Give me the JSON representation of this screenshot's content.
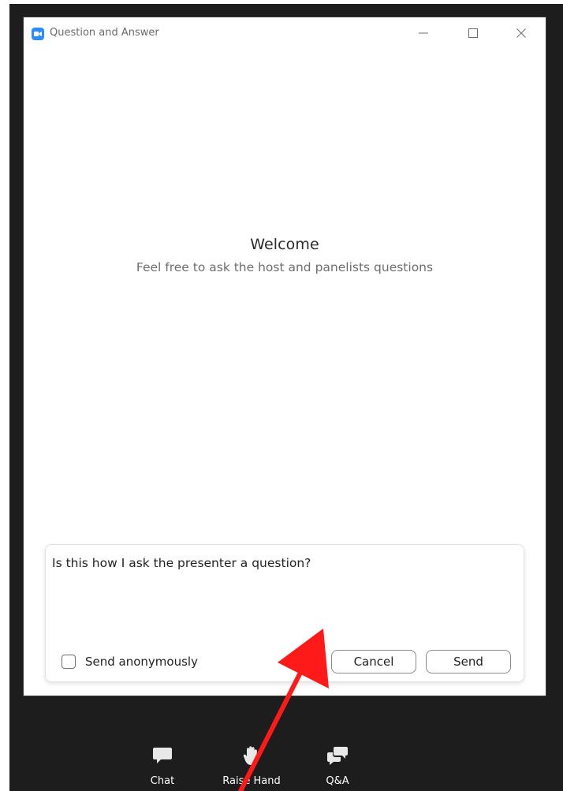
{
  "window": {
    "title": "Question and Answer",
    "controls": {
      "minimize_icon": "minimize-icon",
      "maximize_icon": "maximize-icon",
      "close_icon": "close-icon"
    }
  },
  "welcome": {
    "title": "Welcome",
    "subtitle": "Feel free to ask the host and panelists questions"
  },
  "compose": {
    "question_value": "Is this how I ask the presenter a question?",
    "anonymous_label": "Send anonymously",
    "anonymous_checked": false,
    "cancel_label": "Cancel",
    "send_label": "Send"
  },
  "toolbar": {
    "items": [
      {
        "label": "Chat",
        "icon": "chat-icon"
      },
      {
        "label": "Raise Hand",
        "icon": "raise-hand-icon"
      },
      {
        "label": "Q&A",
        "icon": "qa-icon"
      }
    ]
  },
  "colors": {
    "accent": "#2d8cff",
    "background_dark": "#1d1d1d",
    "annotation_arrow": "#ff1a1a"
  }
}
